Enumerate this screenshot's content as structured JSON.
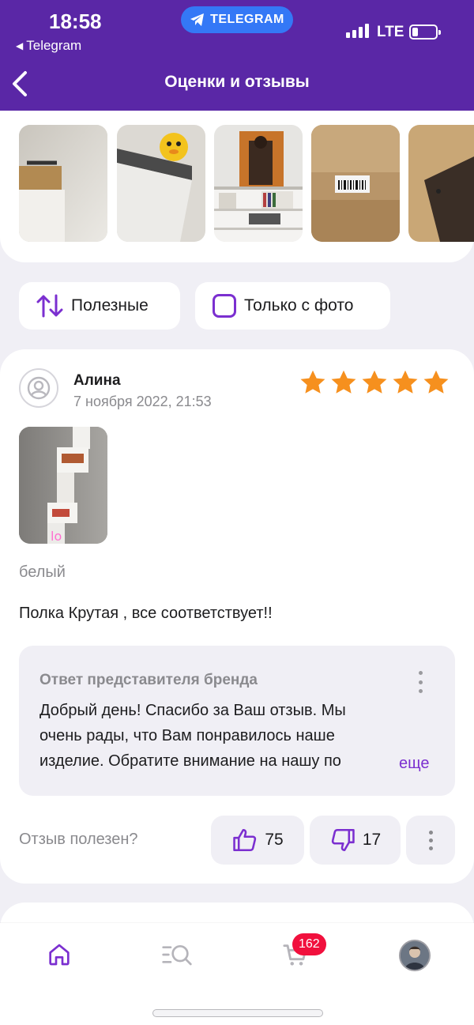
{
  "status_bar": {
    "time": "18:58",
    "back_app": "Telegram",
    "pill": "TELEGRAM",
    "network": "LTE"
  },
  "header": {
    "title": "Оценки и отзывы",
    "back_icon": "chevron-left-icon"
  },
  "photos": [
    {
      "desc": "wall shelf photo"
    },
    {
      "desc": "shelf with plush toy"
    },
    {
      "desc": "shelf with poster"
    },
    {
      "desc": "cardboard box"
    },
    {
      "desc": "dark wood panel"
    }
  ],
  "filters": {
    "sort_label": "Полезные",
    "photo_only_label": "Только с фото"
  },
  "review": {
    "author": "Алина",
    "date": "7 ноября 2022, 21:53",
    "rating": 5,
    "variant": "белый",
    "text": "Полка Крутая , все соответствует!!",
    "reply": {
      "title": "Ответ представителя бренда",
      "line1": "Добрый день! Спасибо за Ваш отзыв. Мы",
      "line2": "очень рады, что Вам понравилось наше",
      "line3": "изделие. Обратите внимание на нашу по",
      "more": "еще"
    },
    "helpful_question": "Отзыв полезен?",
    "likes": "75",
    "dislikes": "17"
  },
  "bottom_nav": {
    "cart_count": "162"
  },
  "colors": {
    "brand": "#5a27a6",
    "accent": "#7b2fd0",
    "star": "#f6901e",
    "badge": "#f1103d"
  }
}
